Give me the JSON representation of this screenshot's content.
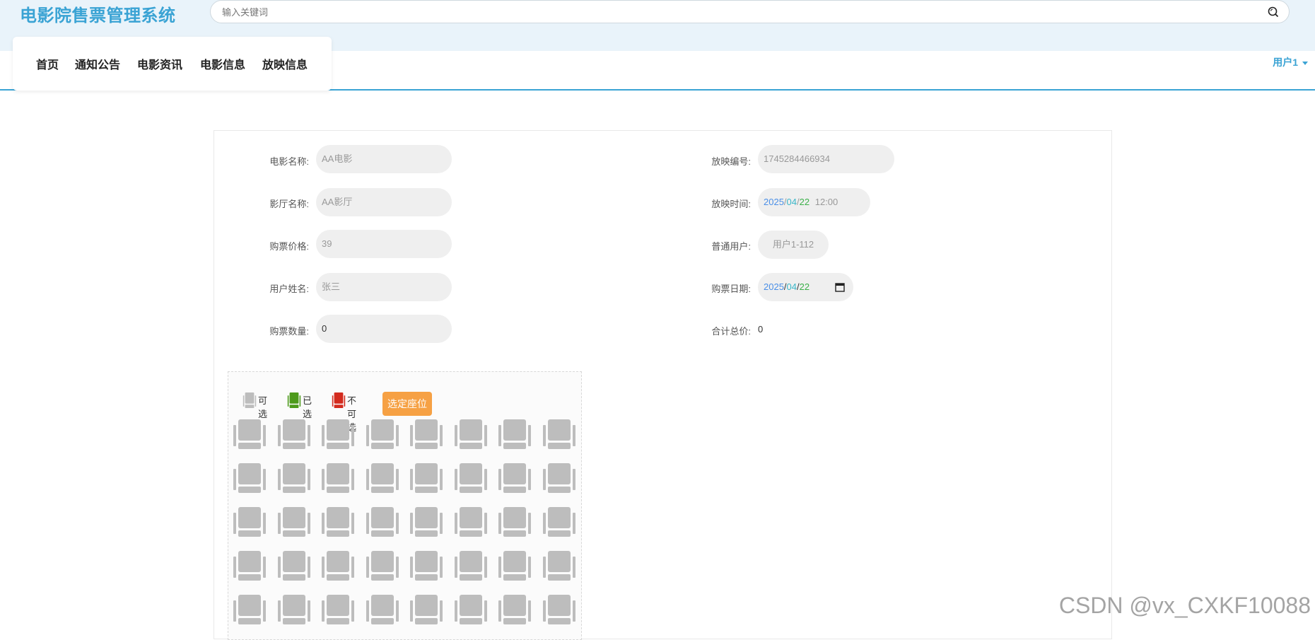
{
  "header": {
    "brand": "电影院售票管理系统",
    "search_placeholder": "输入关键词"
  },
  "nav": {
    "items": [
      "首页",
      "通知公告",
      "电影资讯",
      "电影信息",
      "放映信息"
    ],
    "user": "用户1"
  },
  "form": {
    "left": [
      {
        "label": "电影名称:",
        "value": "AA电影"
      },
      {
        "label": "影厅名称:",
        "value": "AA影厅"
      },
      {
        "label": "购票价格:",
        "value": "39"
      },
      {
        "label": "用户姓名:",
        "value": "张三"
      },
      {
        "label": "购票数量:",
        "value": "0"
      }
    ],
    "right": [
      {
        "label": "放映编号:",
        "value": "1745284466934"
      },
      {
        "label": "放映时间:",
        "year": "2025",
        "month": "04",
        "day": "22",
        "time": "12:00"
      },
      {
        "label": "普通用户:",
        "value": "用户1-112"
      },
      {
        "label": "购票日期:",
        "year": "2025",
        "month": "04",
        "day": "22"
      },
      {
        "label": "合计总价:",
        "value": "0"
      }
    ]
  },
  "seats": {
    "legend": {
      "available": "可选",
      "selected": "已选",
      "unavailable": "不可选"
    },
    "button": "选定座位",
    "colors": {
      "available": "#bdbdbd",
      "selected": "#4d9a1b",
      "unavailable": "#d32b1e",
      "button": "#f6a144"
    },
    "rows": 5,
    "cols": 8
  },
  "watermark": "CSDN @vx_CXKF10088"
}
